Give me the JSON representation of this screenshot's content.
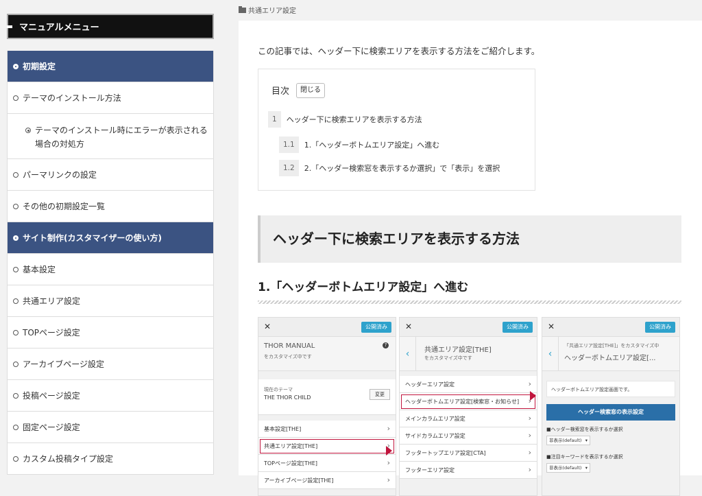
{
  "sidebar": {
    "title": "マニュアルメニュー",
    "items": [
      {
        "label": "初期設定"
      },
      {
        "label": "テーマのインストール方法"
      },
      {
        "label": "テーマのインストール時にエラーが表示される場合の対処方"
      },
      {
        "label": "パーマリンクの設定"
      },
      {
        "label": "その他の初期設定一覧"
      },
      {
        "label": "サイト制作(カスタマイザーの使い方)"
      },
      {
        "label": "基本設定"
      },
      {
        "label": "共通エリア設定"
      },
      {
        "label": "TOPページ設定"
      },
      {
        "label": "アーカイブページ設定"
      },
      {
        "label": "投稿ページ設定"
      },
      {
        "label": "固定ページ設定"
      },
      {
        "label": "カスタム投稿タイプ設定"
      }
    ]
  },
  "breadcrumb": {
    "label": "共通エリア設定"
  },
  "article": {
    "intro": "この記事では、ヘッダー下に検索エリアを表示する方法をご紹介します。",
    "toc": {
      "title": "目次",
      "toggle": "閉じる",
      "items": [
        {
          "num": "1",
          "label": "ヘッダー下に検索エリアを表示する方法"
        },
        {
          "num": "1.1",
          "label": "1.「ヘッダーボトムエリア設定」へ進む"
        },
        {
          "num": "1.2",
          "label": "2.「ヘッダー検索窓を表示するか選択」で「表示」を選択"
        }
      ]
    },
    "h2": "ヘッダー下に検索エリアを表示する方法",
    "h3": "1.「ヘッダーボトムエリア設定」へ進む"
  },
  "shots": {
    "close": "✕",
    "saved": "公開済み",
    "p1": {
      "title": "THOR MANUAL",
      "subtitle": "をカスタマイズ中です",
      "theme_label": "現在のテーマ",
      "theme_name": "THE THOR CHILD",
      "change": "変更",
      "rows": [
        "基本設定[THE]",
        "共通エリア設定[THE]",
        "TOPページ設定[THE]",
        "アーカイブページ設定[THE]"
      ]
    },
    "p2": {
      "title": "共通エリア設定[THE]",
      "subtitle": "をカスタマイズ中です",
      "rows": [
        "ヘッダーエリア設定",
        "ヘッダーボトムエリア設定[検索窓・お知らせ]",
        "メインカラムエリア設定",
        "サイドカラムエリア設定",
        "フッタートップエリア設定[CTA]",
        "フッターエリア設定"
      ]
    },
    "p3": {
      "crumb": "「共通エリア設定[THE]」をカスタマイズ中",
      "title": "ヘッダーボトムエリア設定[...",
      "desc": "ヘッダーボトムエリア設定画面です。",
      "button": "ヘッダー検索窓の表示設定",
      "opt1_label": "■ヘッダー検索窓を表示するか選択",
      "opt1_value": "非表示(default)",
      "opt2_label": "■注目キーワードを表示するか選択",
      "opt2_value": "非表示(default)"
    }
  }
}
